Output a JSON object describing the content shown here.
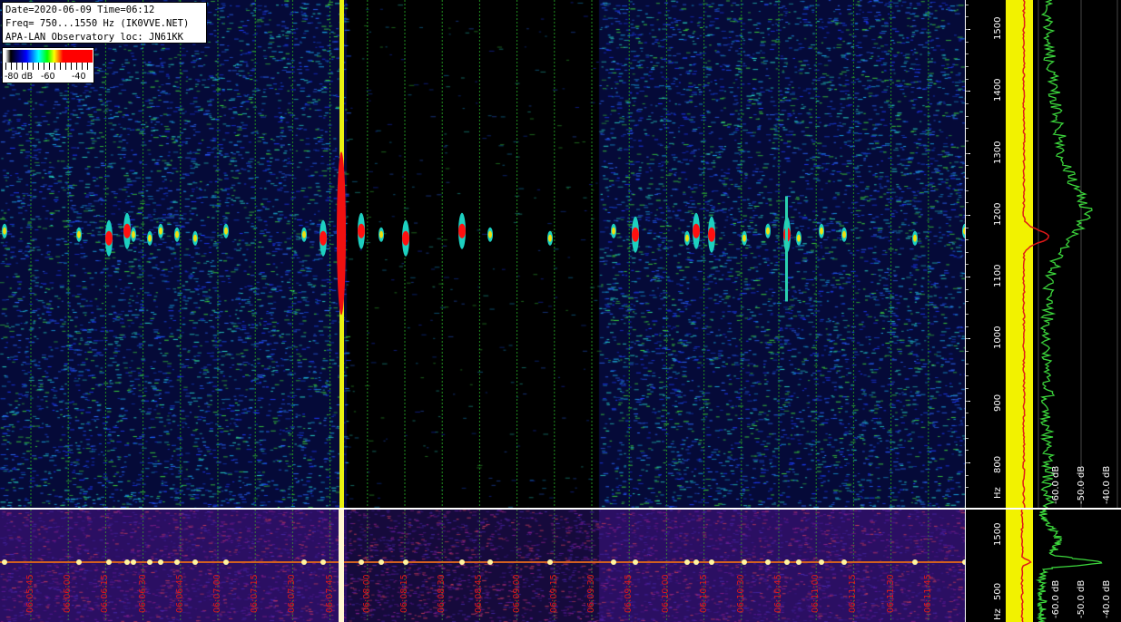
{
  "header_info": {
    "line1": "Date=2020-06-09 Time=06:12",
    "line2": "Freq= 750...1550 Hz (IK0VVE.NET)",
    "line3": "APA-LAN Observatory loc: JN61KK"
  },
  "color_legend": {
    "label_min": "-80 dB",
    "label_mid": "-60",
    "label_max": "-40"
  },
  "freq_axis": {
    "ticks": [
      "1500",
      "1400",
      "1300",
      "1200",
      "1100",
      "1000",
      "900",
      "800"
    ],
    "unit": "Hz",
    "range": [
      750,
      1550
    ]
  },
  "lower_freq_axis": {
    "ticks": [
      "1500",
      "500"
    ],
    "unit": "Hz"
  },
  "spectrum_axis": {
    "labels": [
      "-60.0 dB",
      "-50.0 dB",
      "-40.0 dB"
    ]
  },
  "lower_spectrum_axis": {
    "labels": [
      "-60.0 dB",
      "-50.0 dB",
      "-40.0 dB"
    ]
  },
  "time_axis": {
    "labels": [
      "06:05:45",
      "06:06:00",
      "06:06:15",
      "06:06:30",
      "06:06:45",
      "06:07:00",
      "06:07:15",
      "06:07:30",
      "06:07:45",
      "06:08:00",
      "06:08:15",
      "06:08:30",
      "06:08:45",
      "06:09:00",
      "06:09:15",
      "06:09:30",
      "06:09:45",
      "06:10:00",
      "06:10:15",
      "06:10:30",
      "06:10:45",
      "06:11:00",
      "06:11:15",
      "06:11:30",
      "06:11:45"
    ]
  },
  "colors": {
    "waterfall_bg": "#050a38",
    "grid_line": "#1f8f1f",
    "time_label": "#e01818",
    "spectrum_avg": "#f2f200",
    "spectrum_peak": "#3cd73c",
    "spectrum_trace": "#e01818"
  }
}
